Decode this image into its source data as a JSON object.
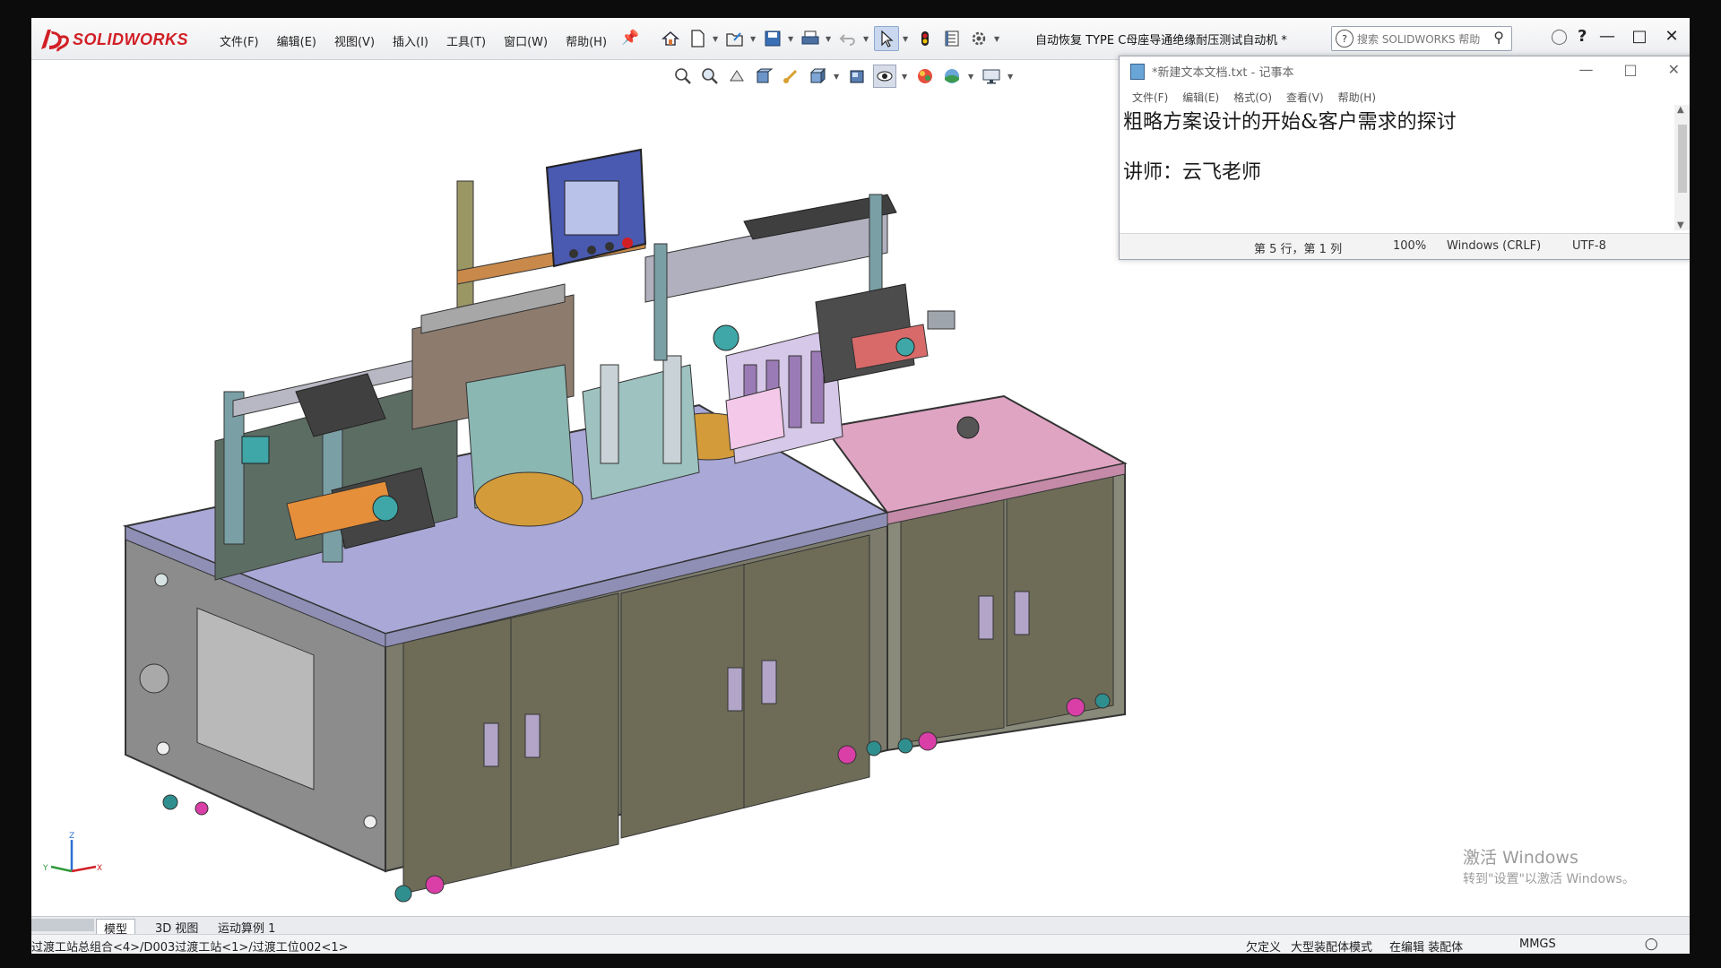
{
  "app": {
    "brand": "SOLIDWORKS",
    "menu": [
      "文件(F)",
      "编辑(E)",
      "视图(V)",
      "插入(I)",
      "工具(T)",
      "窗口(W)",
      "帮助(H)"
    ],
    "document_title": "自动恢复 TYPE C母座导通绝缘耐压测试自动机 *",
    "help_search_placeholder": "搜索 SOLIDWORKS 帮助",
    "toolbar_icons": [
      "home-icon",
      "new-document-icon",
      "open-icon",
      "save-icon",
      "print-icon",
      "undo-icon",
      "select-icon",
      "rebuild-icon",
      "file-properties-icon",
      "options-icon"
    ],
    "view_toolbar_icons": [
      "zoom-to-fit-icon",
      "zoom-area-icon",
      "previous-view-icon",
      "section-view-icon",
      "dynamic-annotation-icon",
      "view-orientation-icon",
      "display-style-icon",
      "hide-show-icon",
      "edit-appearance-icon",
      "apply-scene-icon",
      "view-settings-icon"
    ]
  },
  "notepad": {
    "title": "*新建文本文档.txt - 记事本",
    "menu": [
      "文件(F)",
      "编辑(E)",
      "格式(O)",
      "查看(V)",
      "帮助(H)"
    ],
    "lines": [
      "粗略方案设计的开始&客户需求的探讨",
      "",
      "讲师：云飞老师"
    ],
    "status": {
      "position": "第 5 行，第 1 列",
      "zoom": "100%",
      "line_ending": "Windows (CRLF)",
      "encoding": "UTF-8"
    }
  },
  "tabs": [
    "模型",
    "3D 视图",
    "运动算例 1"
  ],
  "status_bar": {
    "path": "过渡工站总组合<4>/D003过渡工站<1>/过渡工位002<1>",
    "state": "欠定义",
    "mode": "大型装配体模式",
    "editing": "在编辑 装配体",
    "units": "MMGS"
  },
  "watermark": {
    "line1": "激活 Windows",
    "line2": "转到\"设置\"以激活 Windows。"
  },
  "colors": {
    "accent_red": "#d21f26",
    "cabinet_grey": "#8f8f8f",
    "cabinet_door": "#6e6c57",
    "table_top_lavender": "#a9a8d6",
    "table_top_pink": "#e0a4c3",
    "caster_magenta": "#d93fa6"
  }
}
